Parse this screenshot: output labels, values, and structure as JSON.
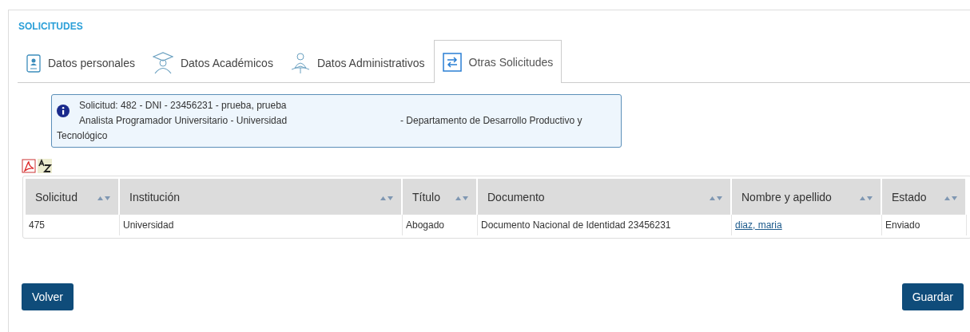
{
  "section_title": "SOLICITUDES",
  "tabs": [
    {
      "label": "Datos personales",
      "kind": "id",
      "selected": false
    },
    {
      "label": "Datos Académicos",
      "kind": "grad",
      "selected": false
    },
    {
      "label": "Datos Administrativos",
      "kind": "admin",
      "selected": false
    },
    {
      "label": "Otras Solicitudes",
      "kind": "swap",
      "selected": true
    }
  ],
  "info": {
    "line_1": "Solicitud: 482 - DNI - 23456231 - prueba, prueba",
    "line_2a": "Analista Programador Universitario - Universidad",
    "line_2b": "- Departamento de Desarrollo Productivo y Tecnológico"
  },
  "table": {
    "columns": [
      "Solicitud",
      "Institución",
      "Título",
      "Documento",
      "Nombre y apellido",
      "Estado"
    ],
    "rows": [
      {
        "cells": [
          "475",
          "Universidad",
          "Abogado",
          "Documento Nacional de Identidad 23456231",
          "diaz, maria",
          "Enviado"
        ]
      }
    ]
  },
  "buttons": {
    "left": "Volver",
    "right": "Guardar"
  }
}
